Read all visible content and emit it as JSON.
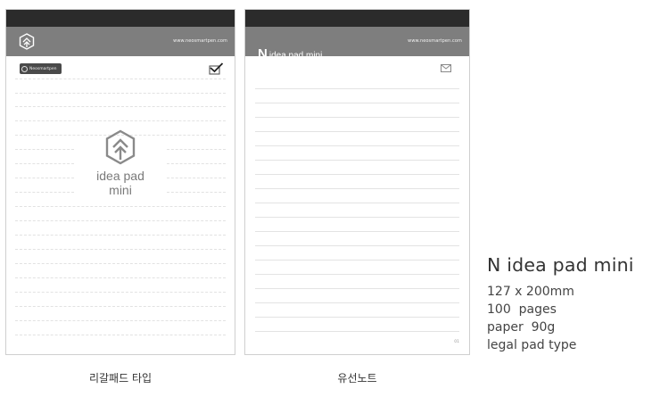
{
  "legal_pad": {
    "url": "www.neosmartpen.com",
    "brand": "Neosmartpen",
    "logo_text": "idea pad mini",
    "caption": "리갈패드 타입"
  },
  "lined_note": {
    "logo_n": "N",
    "logo_text": "idea pad mini",
    "url": "www.neosmartpen.com",
    "page_num": "01",
    "caption": "유선노트"
  },
  "product": {
    "title": "N idea pad mini",
    "specs": [
      "127 x 200mm",
      "100  pages",
      "paper  90g",
      "legal pad type"
    ]
  },
  "icons": {
    "logo": "tree-shield-icon",
    "check": "check-mark-icon",
    "mail": "envelope-icon"
  },
  "colors": {
    "header_dark": "#2b2b2b",
    "header_band": "#7e7e7e",
    "logo_gray": "#8a8a8a"
  }
}
